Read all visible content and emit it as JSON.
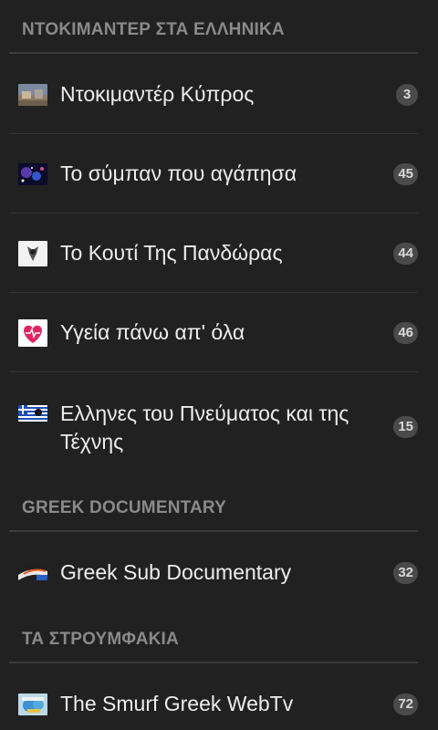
{
  "sections": [
    {
      "title": "ΝΤΟΚΙΜΑΝΤΕΡ ΣΤΑ ΕΛΛΗΝΙΚΑ",
      "items": [
        {
          "label": "Ντοκιμαντέρ Κύπρος",
          "count": "3",
          "icon": "cyprus-documentary-thumbnail-icon"
        },
        {
          "label": "Το σύμπαν που αγάπησα",
          "count": "45",
          "icon": "universe-thumbnail-icon"
        },
        {
          "label": "Το Κουτί Της Πανδώρας",
          "count": "44",
          "icon": "pandora-box-thumbnail-icon"
        },
        {
          "label": "Υγεία πάνω απ' όλα",
          "count": "46",
          "icon": "heart-health-thumbnail-icon"
        },
        {
          "label": "Ελληνες του Πνεύματος και της Τέχνης",
          "count": "15",
          "icon": "greek-flag-thumbnail-icon"
        }
      ]
    },
    {
      "title": "GREEK DOCUMENTARY",
      "items": [
        {
          "label": "Greek Sub Documentary",
          "count": "32",
          "icon": "greek-sub-thumbnail-icon"
        }
      ]
    },
    {
      "title": "ΤΑ ΣΤΡΟΥΜΦΑΚΙΑ",
      "items": [
        {
          "label": "The Smurf Greek WebTv",
          "count": "72",
          "icon": "smurf-thumbnail-icon"
        }
      ]
    }
  ],
  "colors": {
    "background": "#212121",
    "header_text": "#8a8a8a",
    "item_text": "#ededed",
    "badge_bg": "#4a4a4a",
    "badge_text": "#d8d8d8"
  }
}
